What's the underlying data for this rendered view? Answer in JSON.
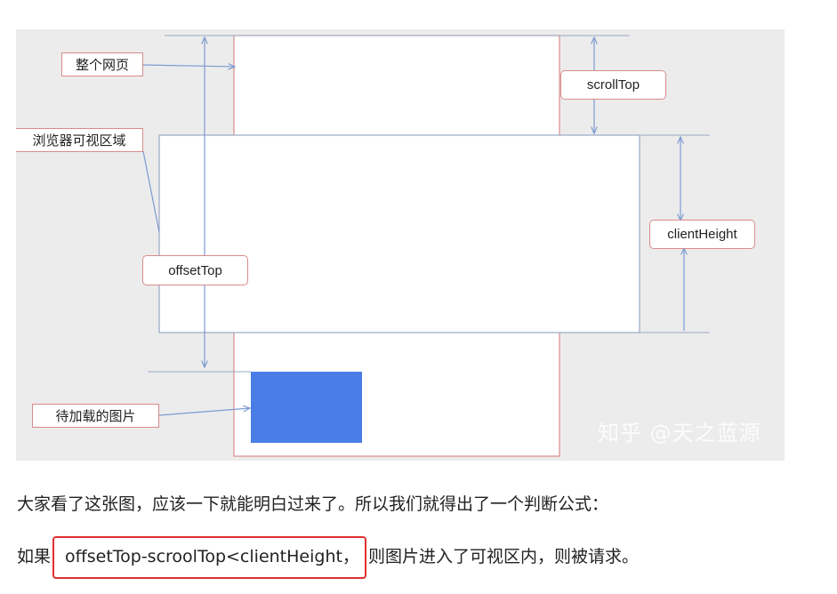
{
  "diagram": {
    "labels": {
      "whole_page": "整个网页",
      "viewport": "浏览器可视区域",
      "scroll_top": "scrollTop",
      "client_height": "clientHeight",
      "offset_top": "offsetTop",
      "image_to_load": "待加载的图片"
    },
    "watermark": "知乎 @天之蓝源",
    "colors": {
      "background": "#ececec",
      "page_border": "#d98b8b",
      "viewport_border": "#9aa7c4",
      "arrow": "#7d9bd1",
      "image_block": "#4a7de6"
    }
  },
  "text": {
    "paragraph1": "大家看了这张图，应该一下就能明白过来了。所以我们就得出了一个判断公式：",
    "paragraph2_prefix": "如果",
    "formula": "offsetTop-scroolTop<clientHeight，",
    "paragraph2_suffix": "则图片进入了可视区内，则被请求。"
  },
  "accent_colors": {
    "formula_box_border": "#e03030"
  }
}
